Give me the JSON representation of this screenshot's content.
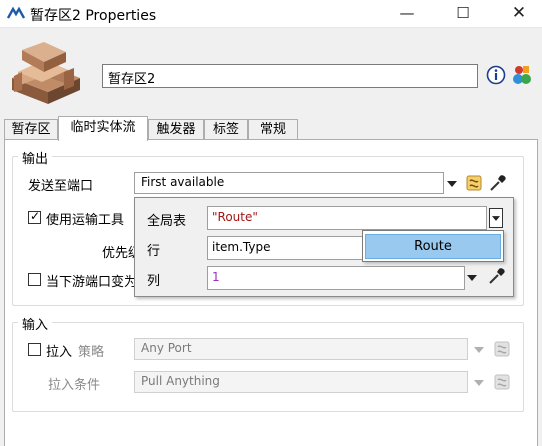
{
  "window": {
    "title": "暂存区2  Properties",
    "controls": {
      "minimize": "—",
      "maximize": "☐",
      "close": "✕"
    }
  },
  "object": {
    "name": "暂存区2"
  },
  "tabs": [
    {
      "label": "暂存区"
    },
    {
      "label": "临时实体流",
      "active": true
    },
    {
      "label": "触发器"
    },
    {
      "label": "标签"
    },
    {
      "label": "常规"
    }
  ],
  "output": {
    "title": "输出",
    "send_to_port_label": "发送至端口",
    "send_to_port_value": "First available",
    "use_transport_label": "使用运输工具",
    "use_transport_checked": true,
    "priority_label": "优先级",
    "downstream_label": "当下游端口变为",
    "downstream_checked": false
  },
  "popup": {
    "global_table_label": "全局表",
    "global_table_value": "\"Route\"",
    "row_label": "行",
    "row_value": "item.Type",
    "column_label": "列",
    "column_value": "1"
  },
  "dropdown": {
    "option": "Route"
  },
  "input": {
    "title": "输入",
    "pull_label": "拉入",
    "pull_checked": false,
    "strategy_label": "策略",
    "strategy_value": "Any Port",
    "pull_condition_label": "拉入条件",
    "pull_condition_value": "Pull Anything"
  },
  "colors": {
    "global_table_value": "#a31515",
    "column_value": "#9b30c0",
    "dropdown_highlight": "#99c9ef"
  }
}
